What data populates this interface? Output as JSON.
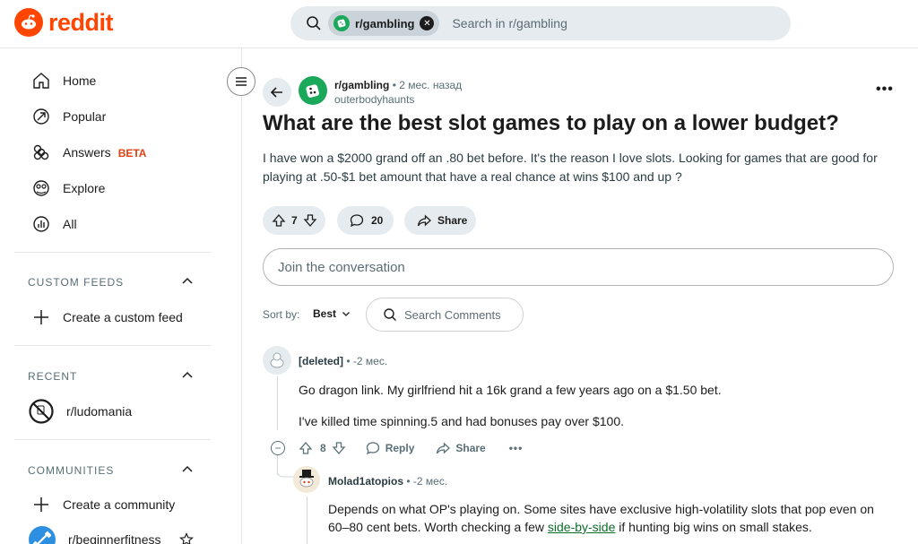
{
  "header": {
    "logo_text": "reddit",
    "search_chip": "r/gambling",
    "search_placeholder": "Search in r/gambling"
  },
  "sidebar": {
    "nav": [
      {
        "label": "Home",
        "icon": "home-icon"
      },
      {
        "label": "Popular",
        "icon": "popular-icon"
      },
      {
        "label": "Answers",
        "icon": "answers-icon",
        "badge": "BETA"
      },
      {
        "label": "Explore",
        "icon": "explore-icon"
      },
      {
        "label": "All",
        "icon": "all-icon"
      }
    ],
    "custom_feeds": {
      "title": "CUSTOM FEEDS",
      "create": "Create a custom feed"
    },
    "recent": {
      "title": "RECENT",
      "items": [
        {
          "label": "r/ludomania"
        }
      ]
    },
    "communities": {
      "title": "COMMUNITIES",
      "create": "Create a community",
      "items": [
        {
          "label": "r/beginnerfitness"
        }
      ]
    }
  },
  "post": {
    "subreddit": "r/gambling",
    "time": "• 2 мес. назад",
    "author": "outerbodyhaunts",
    "title": "What are the best slot games to play on a lower budget?",
    "body": "I have won a $2000 grand off an .80 bet before. It's the reason I love slots. Looking for games that are good for playing at .50-$1 bet amount that have a real chance at wins $100 and up ?",
    "votes": "7",
    "comments": "20",
    "share_label": "Share"
  },
  "join_placeholder": "Join the conversation",
  "sort": {
    "label": "Sort by:",
    "value": "Best",
    "search_label": "Search Comments"
  },
  "comments": [
    {
      "author": "[deleted]",
      "time": "• -2 мес.",
      "lines": [
        "Go dragon link. My girlfriend hit a 16k grand a few years ago on a $1.50 bet.",
        "I've killed time spinning.5 and had bonuses pay over $100."
      ],
      "votes": "8",
      "reply_label": "Reply",
      "share_label": "Share"
    },
    {
      "author": "Molad1atopios",
      "time": "• -2 мес.",
      "text_before": "Depends on what OP's playing on. Some sites have exclusive high-volatility slots that pop even on",
      "text_line2_before": "60–80 cent bets. Worth checking a few ",
      "link": "side-by-side",
      "text_line2_after": " if hunting big wins on small stakes."
    }
  ],
  "colors": {
    "brand": "#ff4500",
    "link": "#0a6e2b",
    "subreddit": "#1aa85a"
  }
}
